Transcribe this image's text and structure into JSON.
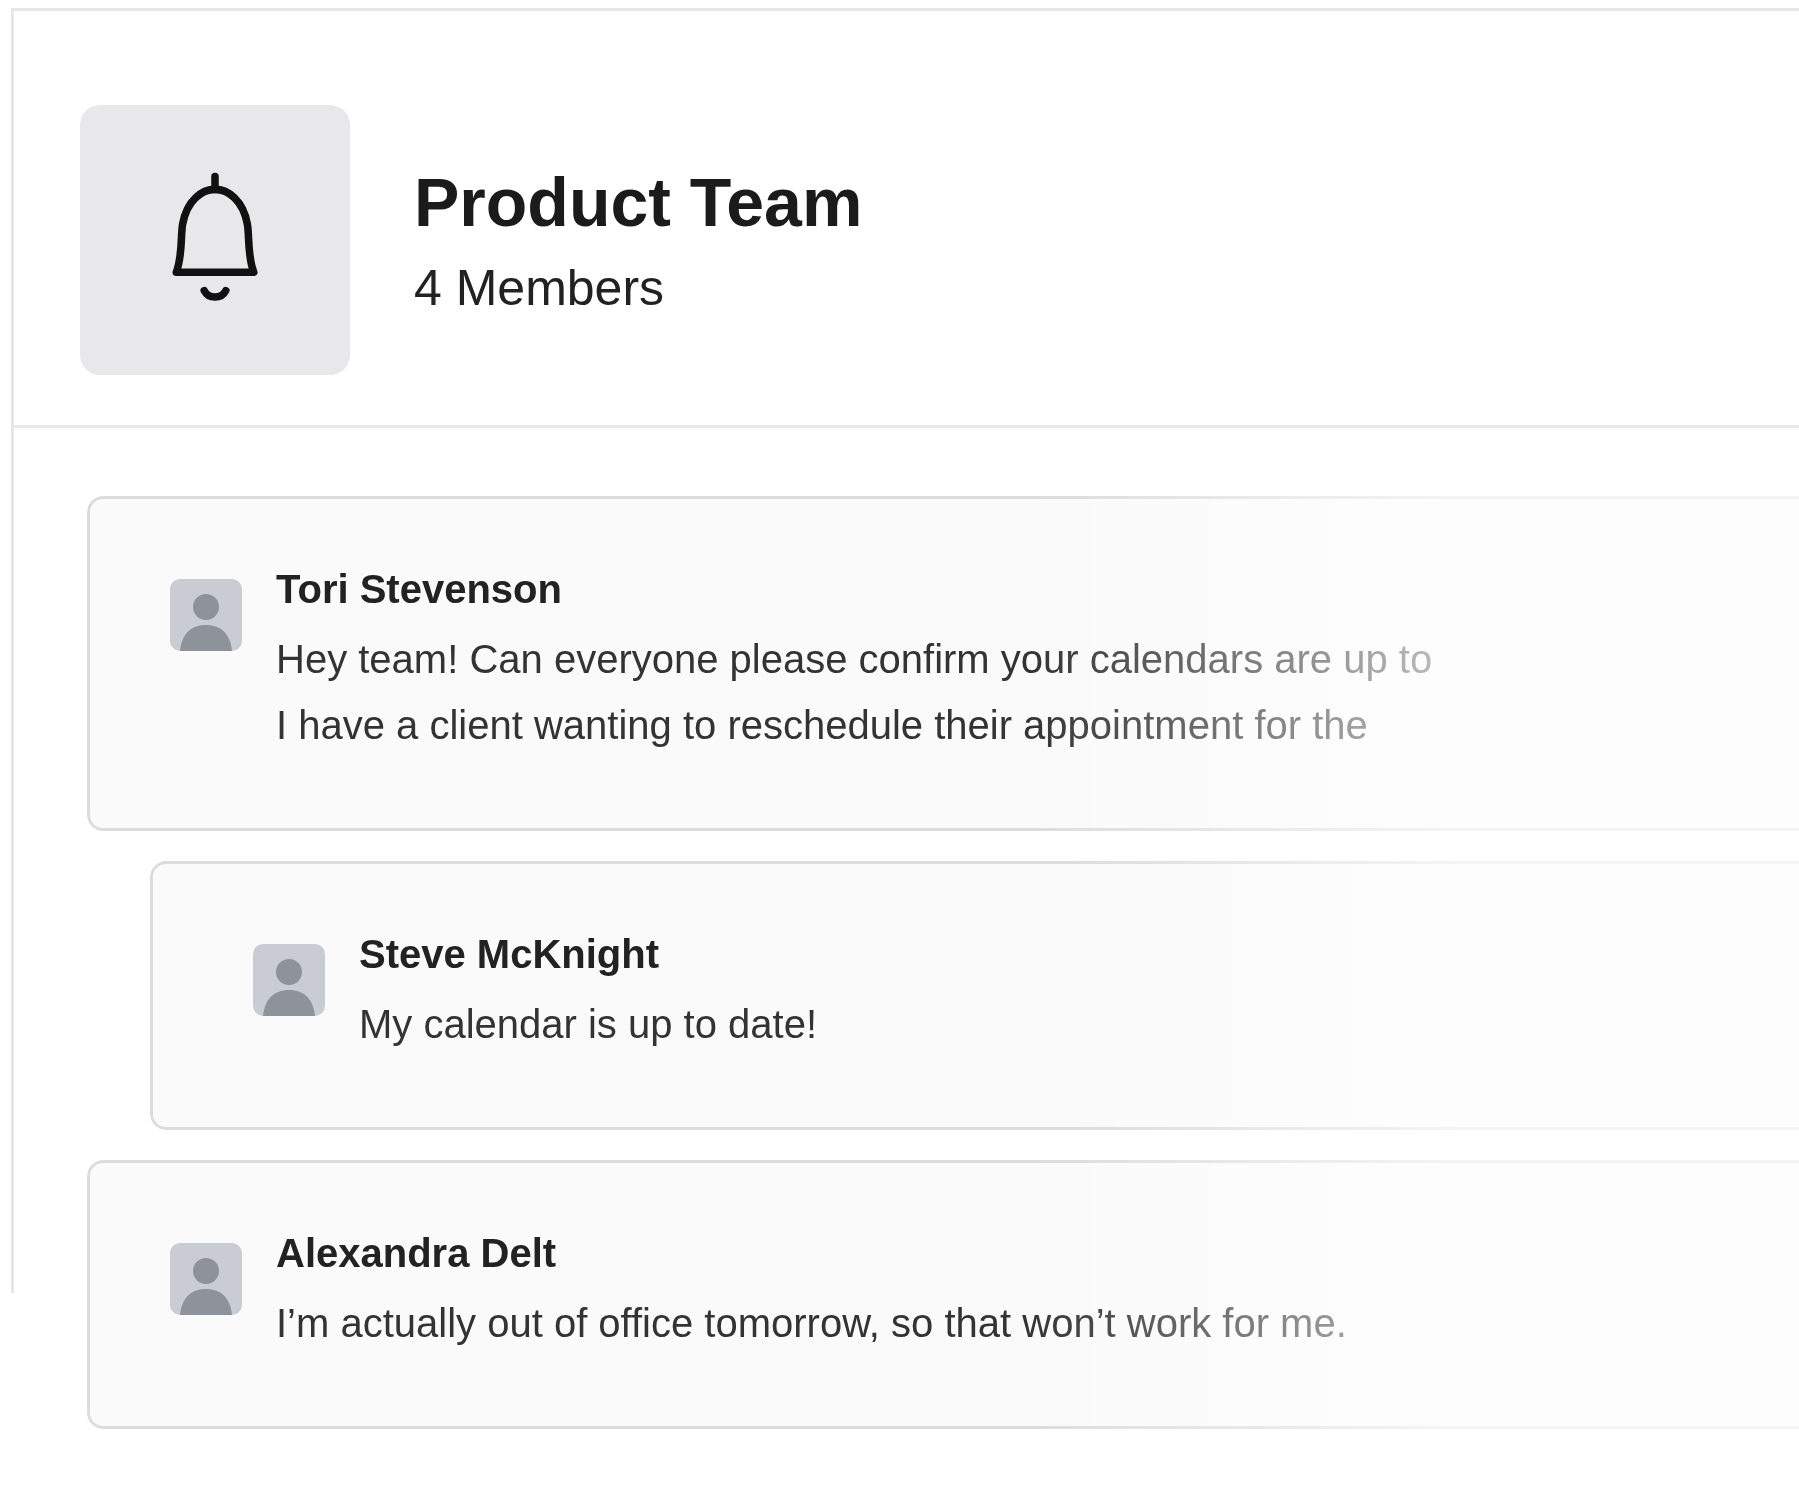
{
  "channel": {
    "title": "Product Team",
    "members": "4 Members"
  },
  "messages": [
    {
      "author": "Tori Stevenson",
      "lines": [
        "Hey team! Can everyone please confirm your calendars are up to",
        "I have a client wanting to reschedule their appointment for the"
      ],
      "children": [
        {
          "author": "Steve McKnight",
          "lines": [
            "My calendar is up to date!"
          ]
        }
      ]
    },
    {
      "author": "Alexandra Delt",
      "lines": [
        "I’m actually out of office tomorrow, so that won’t work for me."
      ]
    }
  ]
}
